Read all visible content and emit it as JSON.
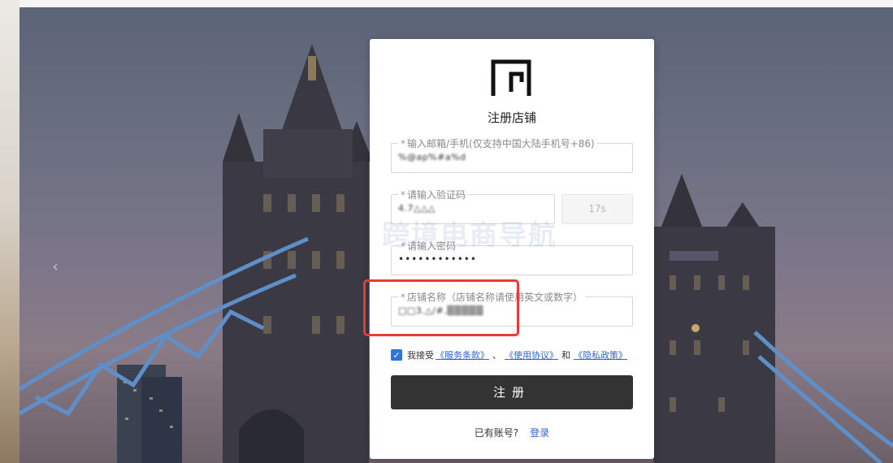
{
  "background": {
    "prev_arrow": "‹"
  },
  "form": {
    "title": "注册店铺",
    "email_label": "输入邮箱/手机(仅支持中国大陆手机号+86)",
    "email_value": "%@ap%#a%d",
    "code_label": "请输入验证码",
    "code_value": "4.7△△△",
    "code_button": "17s",
    "password_label": "请输入密码",
    "password_value": "••••••••••••",
    "shop_label": "店铺名称（店铺名称请使用英文或数字）",
    "shop_value": "□□3.△/#.▒▒▒▒▒",
    "required_mark": "*",
    "agree_text": "我接受",
    "terms_link": "《服务条款》",
    "sep1": "、",
    "usage_link": "《使用协议》",
    "and_text": "和",
    "privacy_link": "《隐私政策》",
    "checkbox_state": "checked",
    "submit_label": "注册",
    "has_account": "已有账号?",
    "login_link": "登录"
  },
  "watermark": "跨境电商导航",
  "colors": {
    "primary_button": "#333333",
    "link": "#2f66d6",
    "checkbox": "#2e74dd",
    "highlight": "#e53b3b"
  }
}
